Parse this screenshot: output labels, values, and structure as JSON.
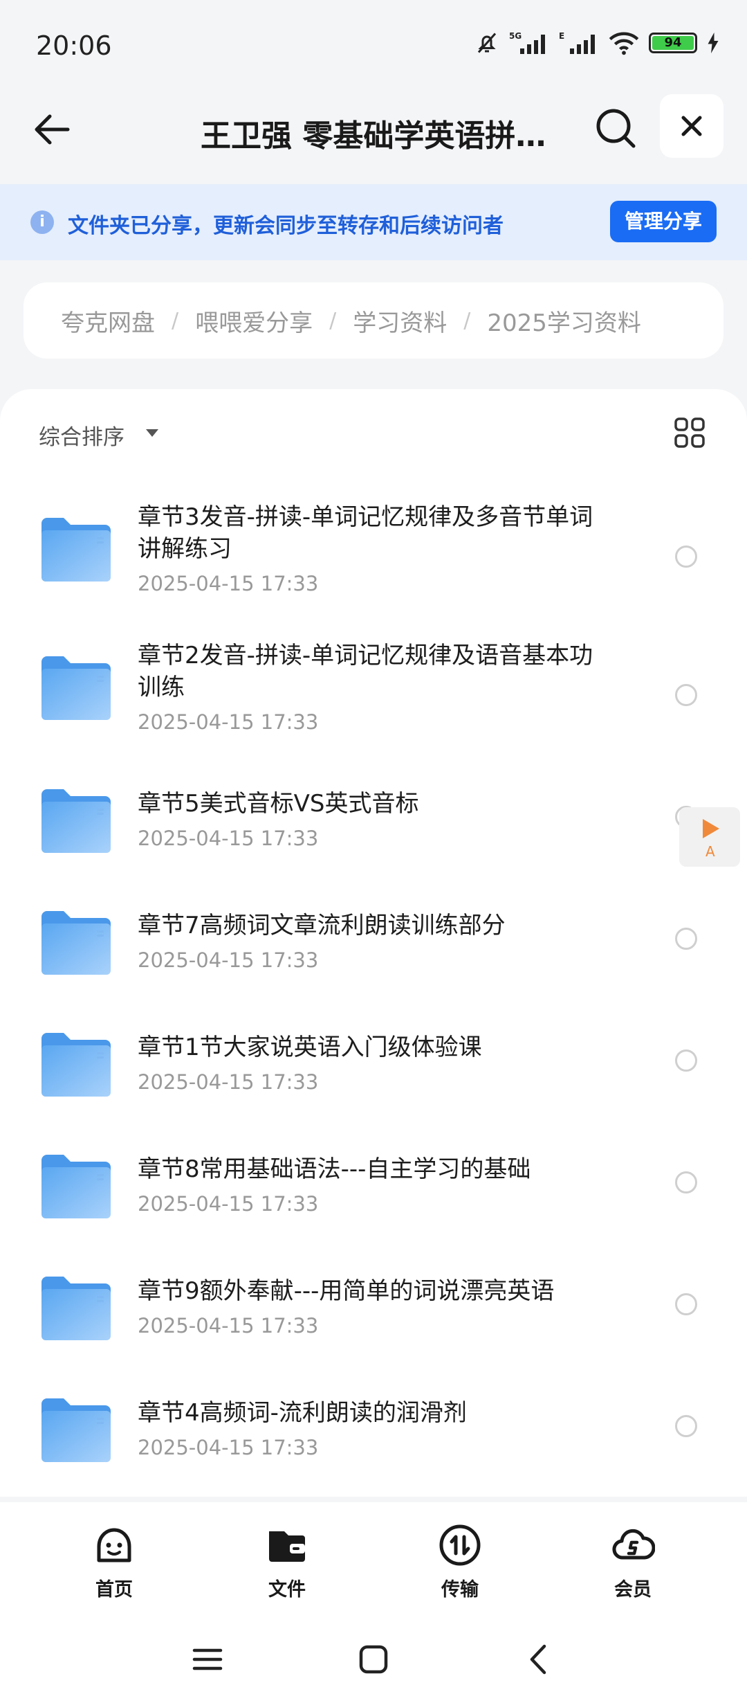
{
  "status": {
    "time": "20:06",
    "battery": "94",
    "network": "5G",
    "network2": "E"
  },
  "header": {
    "title": "王卫强 零基础学英语拼读全程班"
  },
  "banner": {
    "text": "文件夹已分享，更新会同步至转存和后续访问者",
    "button": "管理分享"
  },
  "breadcrumb": [
    "夸克网盘",
    "喂喂爱分享",
    "学习资料",
    "2025学习资料"
  ],
  "toolbar": {
    "sort_label": "综合排序"
  },
  "files": [
    {
      "name": "章节3发音-拼读-单词记忆规律及多音节单词讲解练习",
      "date": "2025-04-15 17:33"
    },
    {
      "name": "章节2发音-拼读-单词记忆规律及语音基本功训练",
      "date": "2025-04-15 17:33"
    },
    {
      "name": "章节5美式音标VS英式音标",
      "date": "2025-04-15 17:33"
    },
    {
      "name": "章节7高频词文章流利朗读训练部分",
      "date": "2025-04-15 17:33"
    },
    {
      "name": "章节1节大家说英语入门级体验课",
      "date": "2025-04-15 17:33"
    },
    {
      "name": "章节8常用基础语法---自主学习的基础",
      "date": "2025-04-15 17:33"
    },
    {
      "name": "章节9额外奉献---用简单的词说漂亮英语",
      "date": "2025-04-15 17:33"
    },
    {
      "name": "章节4高频词-流利朗读的润滑剂",
      "date": "2025-04-15 17:33"
    }
  ],
  "float_tab": {
    "letter": "A"
  },
  "nav": {
    "home": "首页",
    "files": "文件",
    "transfer": "传输",
    "member": "会员"
  },
  "colors": {
    "accent": "#1a6cf4",
    "banner_bg": "#e5eefc",
    "folder": "#6ab0f3"
  }
}
